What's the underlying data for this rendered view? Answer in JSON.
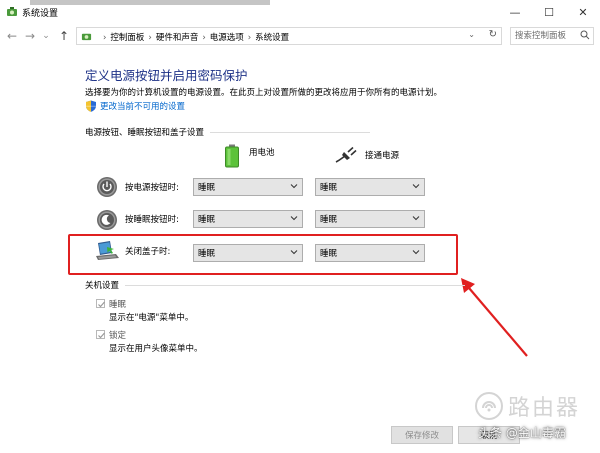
{
  "window": {
    "title": "系统设置",
    "minimize_glyph": "—",
    "maximize_glyph": "☐",
    "close_glyph": "✕"
  },
  "nav": {
    "back_glyph": "←",
    "forward_glyph": "→",
    "recent_glyph": "⌄",
    "up_glyph": "↑"
  },
  "address": {
    "breadcrumbs": [
      "控制面板",
      "硬件和声音",
      "电源选项",
      "系统设置"
    ],
    "separator": "›",
    "dropdown_glyph": "⌄",
    "refresh_glyph": "↻"
  },
  "search": {
    "placeholder": "搜索控制面板"
  },
  "main": {
    "heading": "定义电源按钮并启用密码保护",
    "description": "选择要为你的计算机设置的电源设置。在此页上对设置所做的更改将应用于你所有的电源计划。",
    "change_link": "更改当前不可用的设置"
  },
  "power_section": {
    "title": "电源按钮、睡眠按钮和盖子设置",
    "col_battery": "用电池",
    "col_plugged": "接通电源",
    "rows": [
      {
        "label": "按电源按钮时:",
        "battery": "睡眠",
        "plugged": "睡眠",
        "icon": "power-icon"
      },
      {
        "label": "按睡眠按钮时:",
        "battery": "睡眠",
        "plugged": "睡眠",
        "icon": "sleep-icon"
      },
      {
        "label": "关闭盖子时:",
        "battery": "睡眠",
        "plugged": "睡眠",
        "icon": "laptop-lid-icon"
      }
    ]
  },
  "shutdown_section": {
    "title": "关机设置",
    "items": [
      {
        "label": "睡眠",
        "desc": "显示在\"电源\"菜单中。",
        "checked": true
      },
      {
        "label": "锁定",
        "desc": "显示在用户头像菜单中。",
        "checked": true
      }
    ]
  },
  "footer": {
    "save_label": "保存修改",
    "cancel_label": "取消"
  },
  "watermark": {
    "text": "路由器",
    "credit": "头条 @金山毒霸"
  },
  "colors": {
    "heading": "#1e3287",
    "link": "#0066cc",
    "highlight_box": "#e02020",
    "annotation_arrow": "#e02020"
  }
}
